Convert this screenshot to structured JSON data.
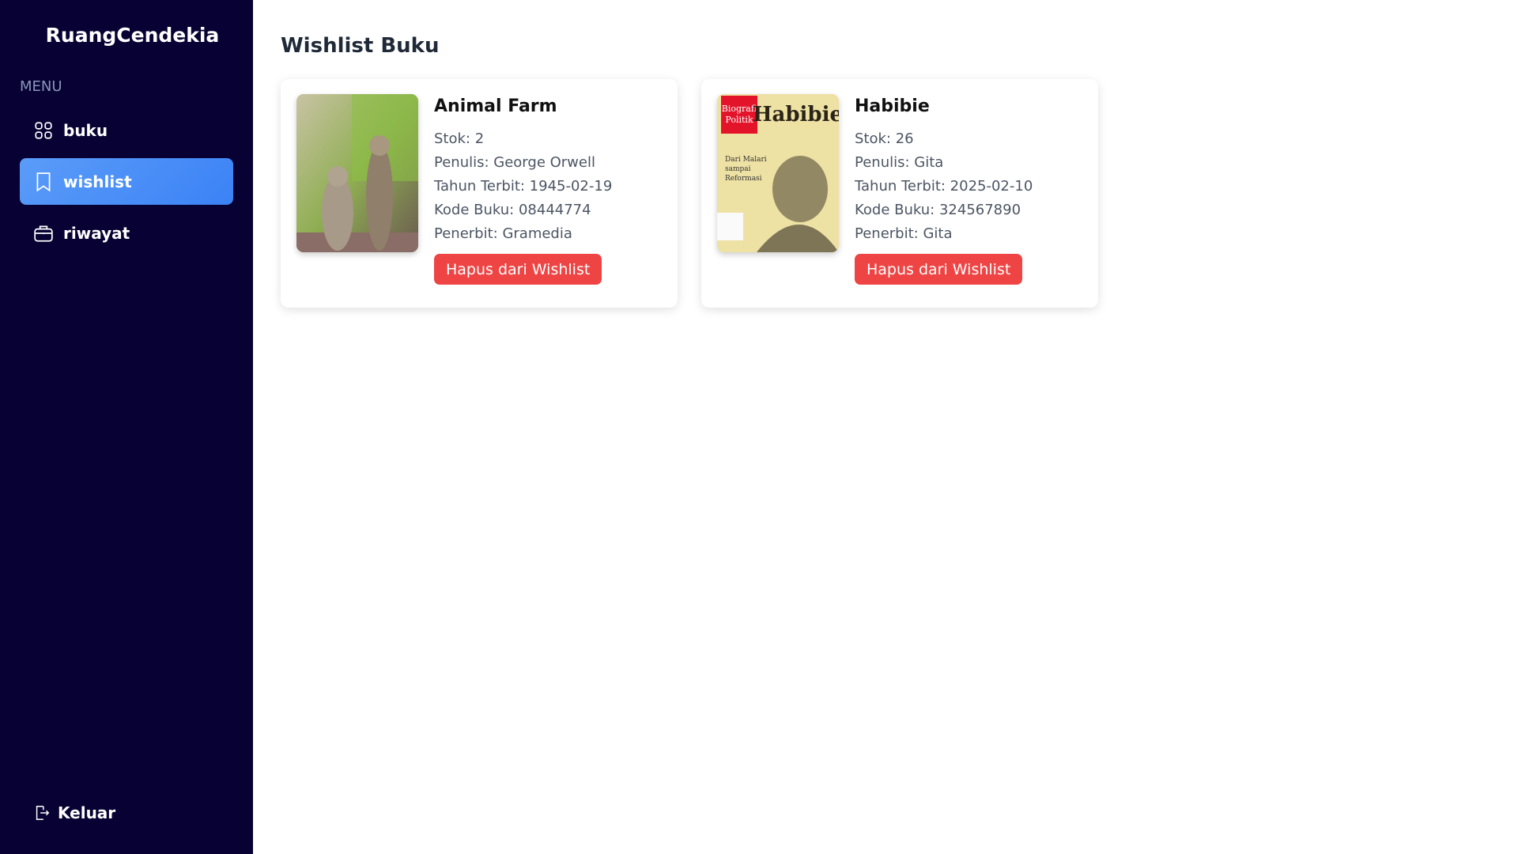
{
  "sidebar": {
    "brand": "RuangCendekia",
    "menu_label": "MENU",
    "items": [
      {
        "label": "buku",
        "icon": "grid-icon"
      },
      {
        "label": "wishlist",
        "icon": "bookmark-icon",
        "active": true
      },
      {
        "label": "riwayat",
        "icon": "briefcase-icon"
      }
    ],
    "logout": "Keluar"
  },
  "main": {
    "title": "Wishlist Buku",
    "books": [
      {
        "title": "Animal Farm",
        "stok": "Stok: 2",
        "penulis": "Penulis: George Orwell",
        "tahun": "Tahun Terbit: 1945-02-19",
        "kode": "Kode Buku: 08444774",
        "penerbit": "Penerbit: Gramedia",
        "button": "Hapus dari Wishlist"
      },
      {
        "title": "Habibie",
        "stok": "Stok: 26",
        "penulis": "Penulis: Gita",
        "tahun": "Tahun Terbit: 2025-02-10",
        "kode": "Kode Buku: 324567890",
        "penerbit": "Penerbit: Gita",
        "button": "Hapus dari Wishlist",
        "cover_text": {
          "badge": "Biografi Politik",
          "title": "Habibie",
          "subtitle": "Dari Malari sampai Reformasi"
        }
      }
    ]
  },
  "colors": {
    "sidebar": "#070233",
    "active": "#3b82f6",
    "danger": "#ef4444"
  }
}
